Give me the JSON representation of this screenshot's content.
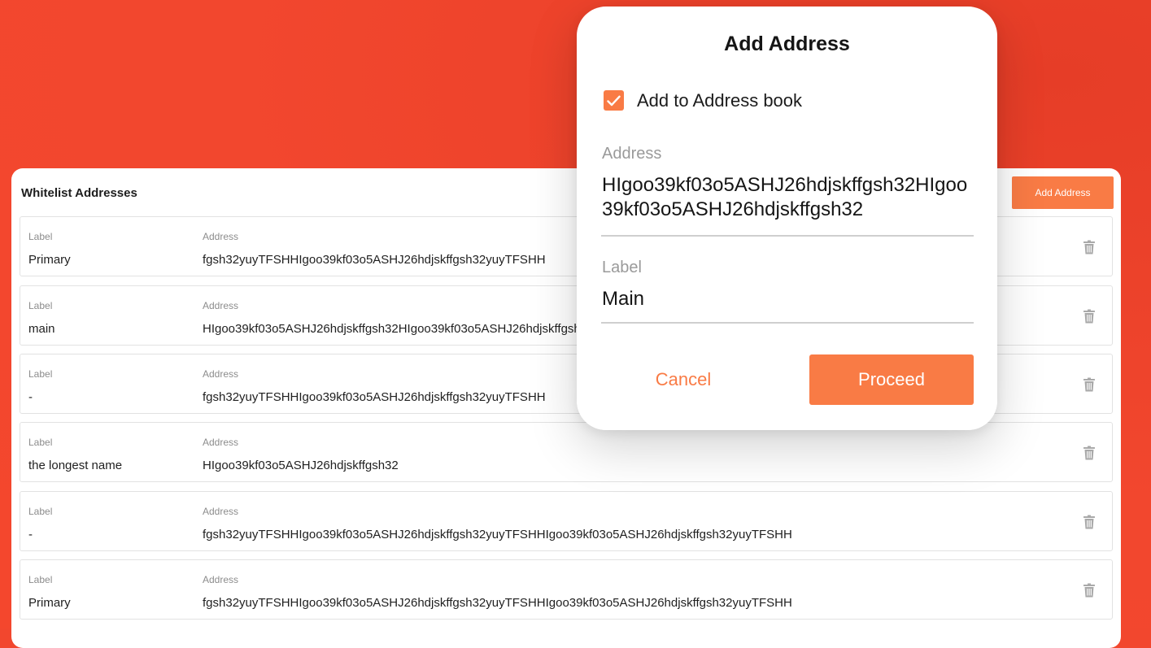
{
  "whitelist": {
    "title": "Whitelist Addresses",
    "add_button_label": "Add Address",
    "label_caption": "Label",
    "address_caption": "Address",
    "rows": [
      {
        "label": "Primary",
        "address": "fgsh32yuyTFSHHIgoo39kf03o5ASHJ26hdjskffgsh32yuyTFSHH"
      },
      {
        "label": "main",
        "address": "HIgoo39kf03o5ASHJ26hdjskffgsh32HIgoo39kf03o5ASHJ26hdjskffgsh32"
      },
      {
        "label": "-",
        "address": "fgsh32yuyTFSHHIgoo39kf03o5ASHJ26hdjskffgsh32yuyTFSHH"
      },
      {
        "label": "the longest name",
        "address": "HIgoo39kf03o5ASHJ26hdjskffgsh32"
      },
      {
        "label": "-",
        "address": "fgsh32yuyTFSHHIgoo39kf03o5ASHJ26hdjskffgsh32yuyTFSHHIgoo39kf03o5ASHJ26hdjskffgsh32yuyTFSHH"
      },
      {
        "label": "Primary",
        "address": "fgsh32yuyTFSHHIgoo39kf03o5ASHJ26hdjskffgsh32yuyTFSHHIgoo39kf03o5ASHJ26hdjskffgsh32yuyTFSHH"
      }
    ],
    "row_icon": "trash-icon"
  },
  "modal": {
    "title": "Add Address",
    "checkbox_label": "Add to Address book",
    "checkbox_checked": true,
    "address_caption": "Address",
    "address_value": "HIgoo39kf03o5ASHJ26hdjskffgsh32HIgoo39kf03o5ASHJ26hdjskffgsh32",
    "label_caption": "Label",
    "label_value": "Main",
    "cancel_label": "Cancel",
    "proceed_label": "Proceed"
  },
  "colors": {
    "background": "#f2472e",
    "accent": "#f97b45",
    "panel": "#ffffff"
  }
}
